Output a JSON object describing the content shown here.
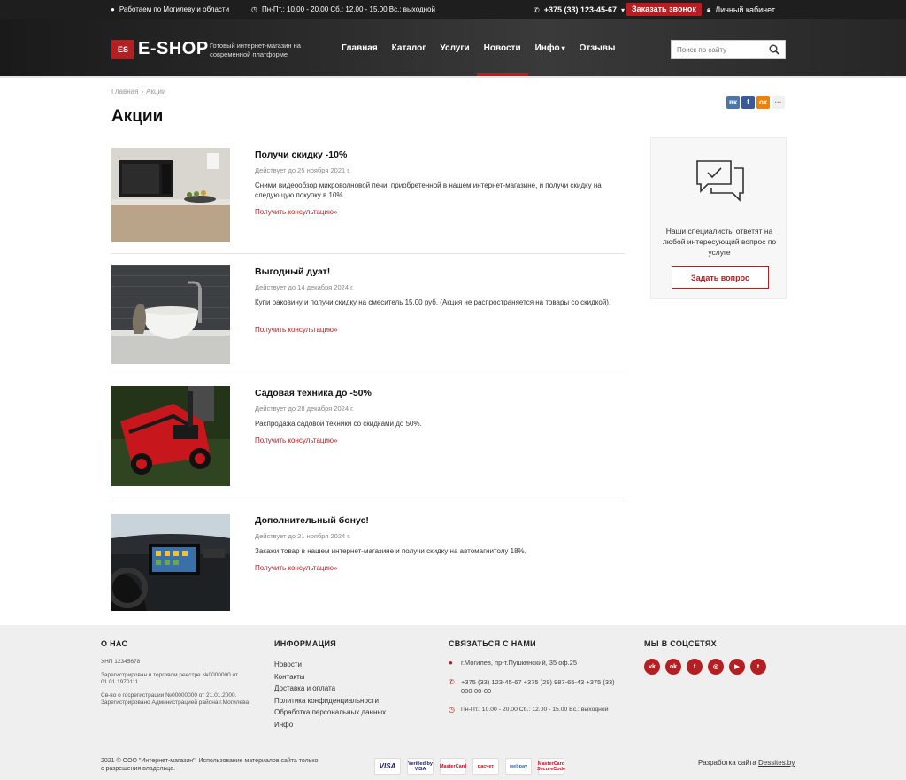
{
  "topbar": {
    "region": "Работаем по Могилеву и области",
    "hours": "Пн-Пт.: 10.00 - 20.00 Сб.: 12.00 - 15.00 Вс.: выходной",
    "phone": "+375 (33) 123-45-67",
    "callback": "Заказать звонок",
    "cabinet": "Личный кабинет"
  },
  "header": {
    "logo_badge": "ES",
    "logo_text": "E-SHOP",
    "tagline": "Готовый интернет-магазин на современной платформе",
    "nav": [
      "Главная",
      "Каталог",
      "Услуги",
      "Новости",
      "Инфо",
      "Отзывы"
    ],
    "search_placeholder": "Поиск по сайту"
  },
  "breadcrumb": {
    "home": "Главная",
    "sep": "›",
    "current": "Акции"
  },
  "page_title": "Акции",
  "share": {
    "vk": "вк",
    "fb": "f",
    "ok": "ок",
    "more": "···"
  },
  "promos": [
    {
      "title": "Получи скидку -10%",
      "date": "Действует до 25 ноября 2021 г.",
      "desc": "Сними видеообзор микроволновой печи, приобретенной в нашем интернет-магазине, и получи скидку на следующую покупку в 10%.",
      "link": "Получить консультацию»"
    },
    {
      "title": "Выгодный дуэт!",
      "date": "Действует до 14 декабря 2024 г.",
      "desc": "Купи раковину и получи скидку на смеситель 15.00 руб. (Акция не распространяется на товары со скидкой).",
      "link": "Получить консультацию»"
    },
    {
      "title": "Садовая техника до -50%",
      "date": "Действует до 28 декабря 2024 г.",
      "desc": "Распродажа садовой техники со скидками до 50%.",
      "link": "Получить консультацию»"
    },
    {
      "title": "Дополнительный бонус!",
      "date": "Действует до 21 ноября 2024 г.",
      "desc": "Закажи товар в нашем интернет-магазине и получи скидку на автомагнитолу 18%.",
      "link": "Получить консультацию»"
    }
  ],
  "side": {
    "text": "Наши специалисты ответят на любой интересующий вопрос по услуге",
    "button": "Задать вопрос"
  },
  "footer": {
    "about": {
      "title": "О НАС",
      "unp": "УНП 12345678",
      "reg": "Зарегистрирован в торговом реестре №0000000 от 01.01.1970111",
      "cert": "Св-во о госрегистрации №00000000 от 21.01.2000. Зарегистрировано Администрацией района г.Могилева"
    },
    "info": {
      "title": "ИНФОРМАЦИЯ",
      "links": [
        "Новости",
        "Контакты",
        "Доставка и оплата",
        "Политика конфиденциальности",
        "Обработка персональных данных",
        "Инфо"
      ]
    },
    "contact": {
      "title": "СВЯЗАТЬСЯ С НАМИ",
      "address": "г.Могилев, пр-т.Пушкинский, 35 оф.25",
      "phones": "+375 (33) 123-45-67  +375 (29) 987-65-43 +375 (33) 000-00-00",
      "hours": "Пн-Пт.: 10.00 - 20.00 Сб.: 12.00 - 15.00 Вс.: выходной"
    },
    "social": {
      "title": "МЫ В СОЦСЕТЯХ",
      "items": [
        "vk",
        "ok",
        "fb",
        "ig",
        "yt",
        "tw"
      ]
    },
    "copyright": "2021 © ООО \"Интернет-магазин\". Использование материалов сайта только с разрешения владельца.",
    "payments": [
      "VISA",
      "Verified by VISA",
      "MasterCard",
      "расчет",
      "webpay",
      "MasterCard SecureCode"
    ],
    "dev_prefix": "Разработка сайта ",
    "dev_link": "Dessites.by"
  },
  "colors": {
    "accent": "#b41f23",
    "topbar": "#1e1e1e",
    "footer": "#efefef"
  }
}
